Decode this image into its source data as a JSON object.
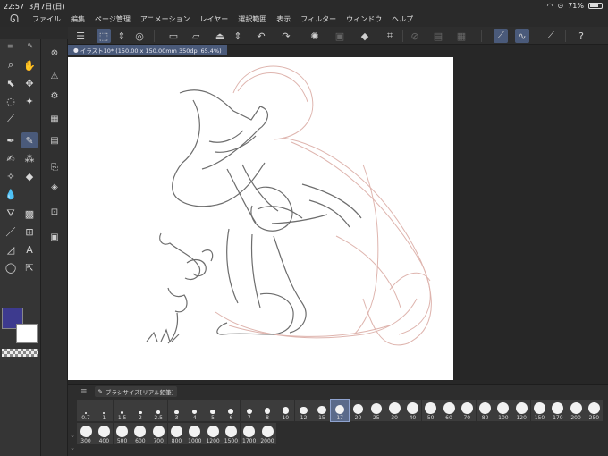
{
  "status": {
    "time": "22:57",
    "date": "3月7日(日)",
    "battery": "71%"
  },
  "menu": {
    "items": [
      "ファイル",
      "編集",
      "ページ管理",
      "アニメーション",
      "レイヤー",
      "選択範囲",
      "表示",
      "フィルター",
      "ウィンドウ",
      "ヘルプ"
    ]
  },
  "document": {
    "tab_title": "イラスト10* (150.00 x 150.00mm 350dpi 65.4%)"
  },
  "colors": {
    "main": "#3d3a8e",
    "sub": "#ffffff",
    "accent": "#4a5a7a"
  },
  "brush_panel": {
    "title": "ブラシサイズ[リアル鉛筆]",
    "selected": "17",
    "sizes_row1": [
      "0.7",
      "1",
      "1.5",
      "2",
      "2.5",
      "3",
      "4",
      "5",
      "6",
      "7",
      "8",
      "10",
      "12",
      "15",
      "17",
      "20",
      "25",
      "30",
      "40",
      "50",
      "60",
      "70",
      "80",
      "100",
      "120",
      "150",
      "170",
      "200",
      "250"
    ],
    "sizes_row2": [
      "300",
      "400",
      "500",
      "600",
      "700",
      "800",
      "1000",
      "1200",
      "1500",
      "1700",
      "2000"
    ]
  },
  "icons": {
    "toolbar": [
      "menu-icon",
      "select-mode-icon",
      "expand-icon",
      "view-icon",
      "new-file-icon",
      "open-file-icon",
      "save-icon",
      "save-arrows-icon",
      "undo-icon",
      "redo-icon",
      "loading-icon",
      "eraser-icon",
      "fill-icon",
      "transform-icon",
      "clear-selection-icon",
      "invert-selection-icon",
      "expand-selection-icon",
      "stabilizer-icon",
      "pen-pressure-icon",
      "pen-vector-icon",
      "help-icon"
    ]
  }
}
